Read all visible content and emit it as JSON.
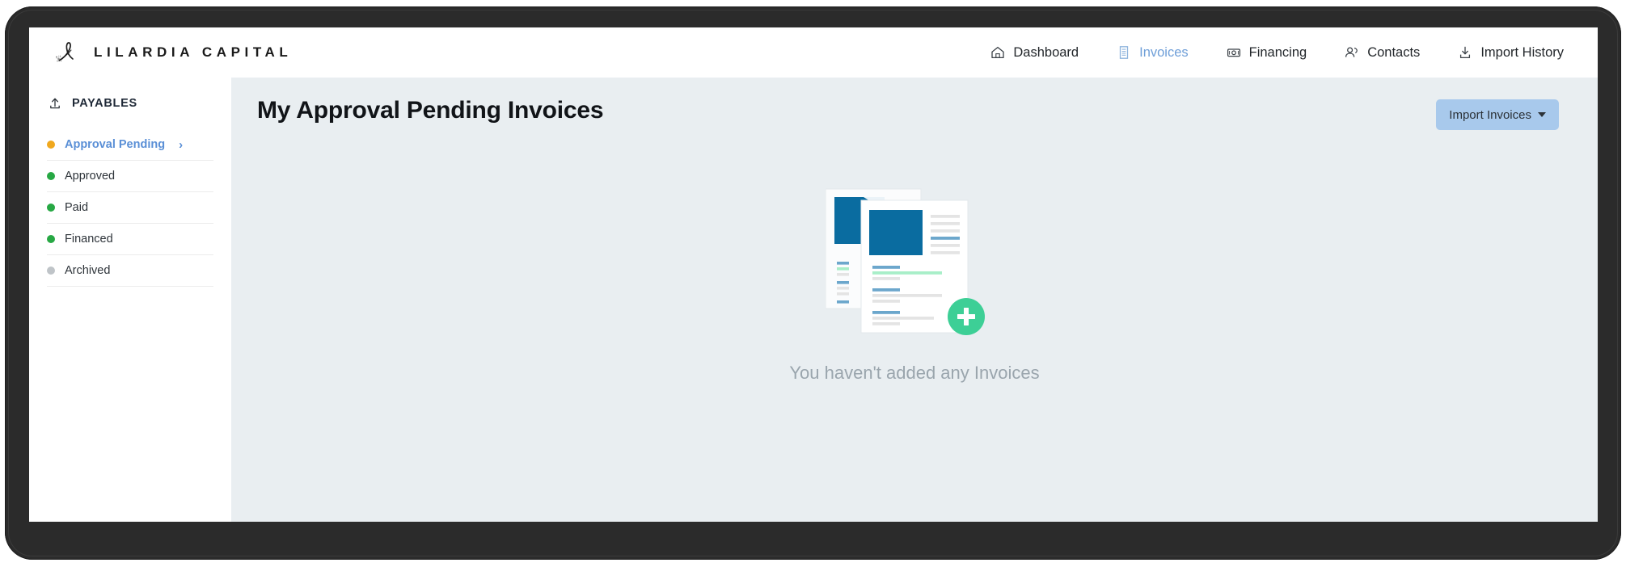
{
  "brand": {
    "logo_icon": "script-l-monogram-icon",
    "name": "LILARDIA CAPITAL"
  },
  "topnav": {
    "items": [
      {
        "label": "Dashboard",
        "icon": "home-icon",
        "active": false
      },
      {
        "label": "Invoices",
        "icon": "document-icon",
        "active": true
      },
      {
        "label": "Financing",
        "icon": "banknote-icon",
        "active": false
      },
      {
        "label": "Contacts",
        "icon": "people-icon",
        "active": false
      },
      {
        "label": "Import History",
        "icon": "import-download-icon",
        "active": false
      }
    ],
    "active_color": "#6f9fd8",
    "text_color": "#23272b"
  },
  "sidebar": {
    "header": {
      "label": "PAYABLES",
      "icon": "upload-icon"
    },
    "items": [
      {
        "label": "Approval Pending",
        "dot_color": "#f0a81e",
        "active": true,
        "chevron": "›"
      },
      {
        "label": "Approved",
        "dot_color": "#27a844",
        "active": false,
        "chevron": ""
      },
      {
        "label": "Paid",
        "dot_color": "#27a844",
        "active": false,
        "chevron": ""
      },
      {
        "label": "Financed",
        "dot_color": "#27a844",
        "active": false,
        "chevron": ""
      },
      {
        "label": "Archived",
        "dot_color": "#bfc4c8",
        "active": false,
        "chevron": ""
      }
    ]
  },
  "main": {
    "title": "My Approval Pending Invoices",
    "import_button": {
      "label": "Import Invoices",
      "icon": "caret-down-icon"
    },
    "empty_state": {
      "message": "You haven't added any Invoices",
      "illustration": "stacked-invoice-documents-with-add-badge",
      "badge_icon": "plus-icon"
    }
  },
  "colors": {
    "content_background": "#e9eef1",
    "panel_background": "#ffffff",
    "accent_blue": "#0a6ca0",
    "accent_green": "#3dcf96",
    "button_blue": "#a8c9ec",
    "bezel": "#2b2b2b"
  }
}
